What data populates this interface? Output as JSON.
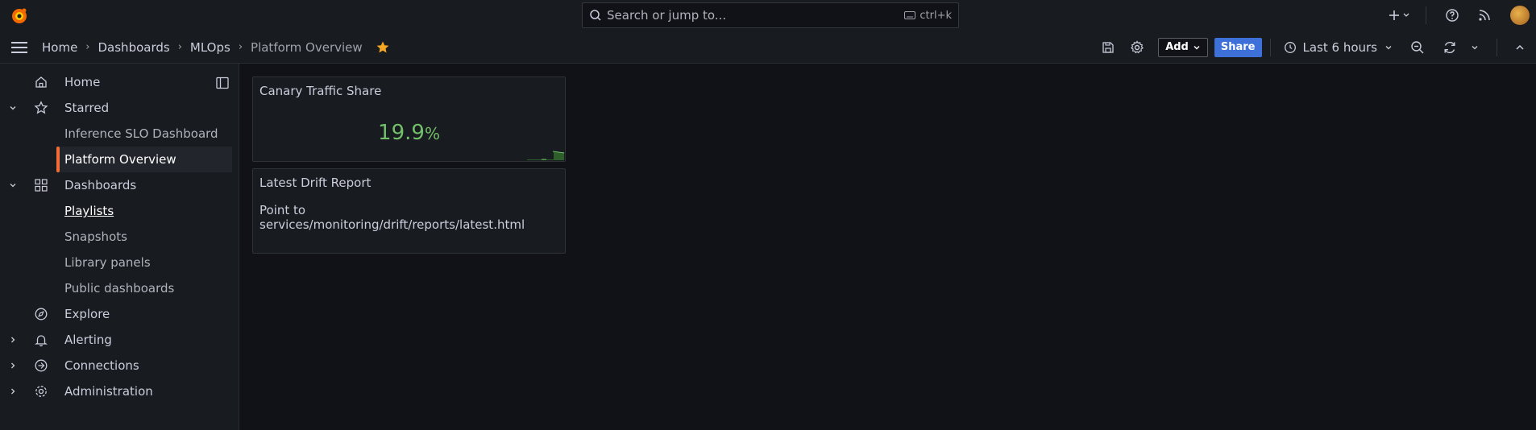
{
  "topbar": {
    "search_placeholder": "Search or jump to...",
    "search_shortcut": "ctrl+k",
    "icons": [
      "grafana-logo-icon",
      "search-icon",
      "keyboard-icon",
      "plus-icon",
      "help-icon",
      "rss-icon",
      "user-avatar"
    ]
  },
  "breadcrumbs": [
    "Home",
    "Dashboards",
    "MLOps",
    "Platform Overview"
  ],
  "toolbar": {
    "add_label": "Add",
    "share_label": "Share",
    "time_range": "Last 6 hours"
  },
  "sidebar": {
    "items": [
      {
        "label": "Home"
      },
      {
        "label": "Starred"
      },
      {
        "label": "Inference SLO Dashboard"
      },
      {
        "label": "Platform Overview"
      },
      {
        "label": "Dashboards"
      },
      {
        "label": "Playlists"
      },
      {
        "label": "Snapshots"
      },
      {
        "label": "Library panels"
      },
      {
        "label": "Public dashboards"
      },
      {
        "label": "Explore"
      },
      {
        "label": "Alerting"
      },
      {
        "label": "Connections"
      },
      {
        "label": "Administration"
      }
    ]
  },
  "panels": {
    "canary": {
      "title": "Canary Traffic Share",
      "value": "19.9",
      "unit": "%"
    },
    "drift": {
      "title": "Latest Drift Report",
      "text": "Point to services/monitoring/drift/reports/latest.html"
    }
  },
  "colors": {
    "accent": "#f16f36",
    "stat_green": "#73bf69",
    "share_blue": "#3d71d9",
    "star_orange": "#f5a623"
  }
}
